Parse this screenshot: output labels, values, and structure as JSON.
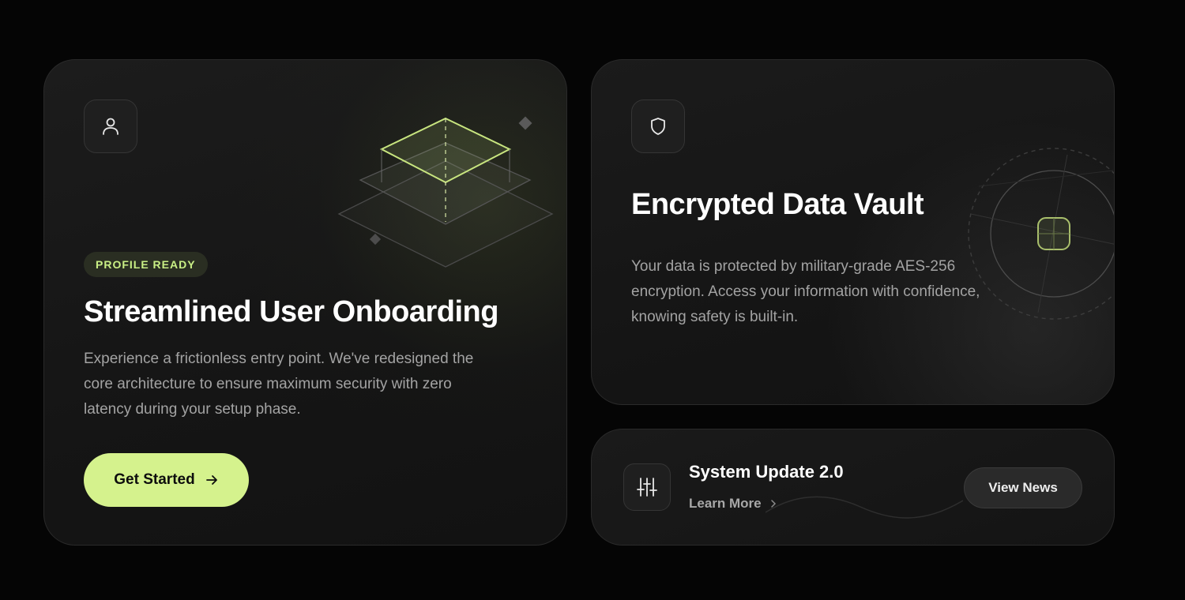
{
  "onboarding": {
    "badge": "PROFILE READY",
    "title": "Streamlined User Onboarding",
    "description": "Experience a frictionless entry point. We've redesigned the core architecture to ensure maximum security with zero latency during your setup phase.",
    "cta_label": "Get Started",
    "icon": "user-icon"
  },
  "vault": {
    "title": "Encrypted Data Vault",
    "description": "Your data is protected by military-grade AES-256 encryption. Access your information with confidence, knowing safety is built-in.",
    "icon": "shield-icon"
  },
  "update": {
    "title": "System Update 2.0",
    "link_label": "Learn More",
    "button_label": "View News",
    "icon": "sliders-icon"
  },
  "colors": {
    "accent": "#d5f28d",
    "badge_text": "#c9ef85",
    "background": "#050505",
    "card": "#161616"
  }
}
